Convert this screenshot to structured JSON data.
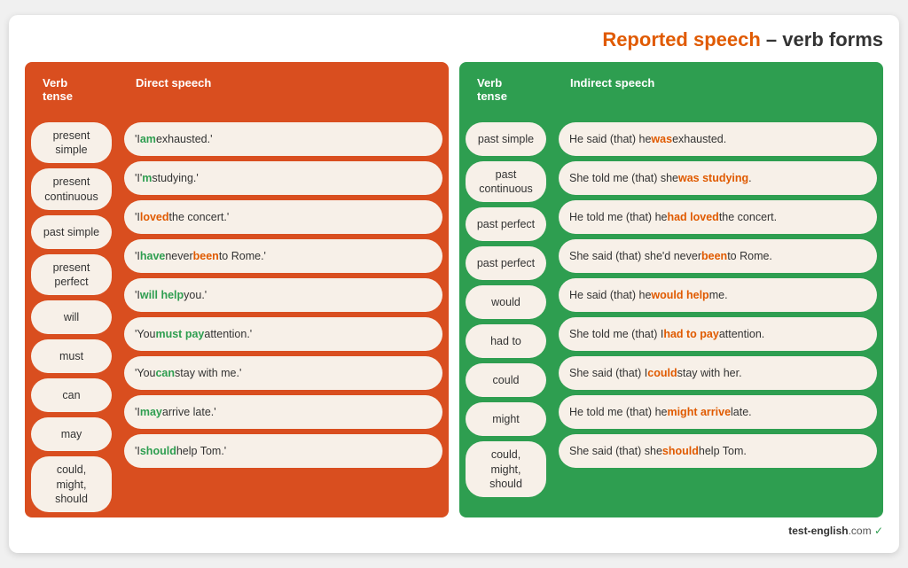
{
  "title": {
    "part1": "Reported speech",
    "separator": " – ",
    "part2": "verb forms"
  },
  "direct": {
    "col1_header": "Verb tense",
    "col2_header": "Direct speech",
    "rows": [
      {
        "tense": "present\nsimple",
        "speech_parts": [
          {
            "text": "'I ",
            "highlight": null
          },
          {
            "text": "am",
            "highlight": "green"
          },
          {
            "text": " exhausted.'",
            "highlight": null
          }
        ]
      },
      {
        "tense": "present\ncontinuous",
        "speech_parts": [
          {
            "text": "'I'",
            "highlight": null
          },
          {
            "text": "m",
            "highlight": "green"
          },
          {
            "text": " studying.'",
            "highlight": null
          }
        ]
      },
      {
        "tense": "past simple",
        "speech_parts": [
          {
            "text": "'I ",
            "highlight": null
          },
          {
            "text": "loved",
            "highlight": "orange"
          },
          {
            "text": " the concert.'",
            "highlight": null
          }
        ]
      },
      {
        "tense": "present\nperfect",
        "speech_parts": [
          {
            "text": "'I ",
            "highlight": null
          },
          {
            "text": "have",
            "highlight": "green"
          },
          {
            "text": " never ",
            "highlight": null
          },
          {
            "text": "been",
            "highlight": "orange"
          },
          {
            "text": " to Rome.'",
            "highlight": null
          }
        ]
      },
      {
        "tense": "will",
        "speech_parts": [
          {
            "text": "'I ",
            "highlight": null
          },
          {
            "text": "will help",
            "highlight": "green"
          },
          {
            "text": " you.'",
            "highlight": null
          }
        ]
      },
      {
        "tense": "must",
        "speech_parts": [
          {
            "text": "'You ",
            "highlight": null
          },
          {
            "text": "must pay",
            "highlight": "green"
          },
          {
            "text": " attention.'",
            "highlight": null
          }
        ]
      },
      {
        "tense": "can",
        "speech_parts": [
          {
            "text": "'You ",
            "highlight": null
          },
          {
            "text": "can",
            "highlight": "green"
          },
          {
            "text": " stay with me.'",
            "highlight": null
          }
        ]
      },
      {
        "tense": "may",
        "speech_parts": [
          {
            "text": "'I ",
            "highlight": null
          },
          {
            "text": "may",
            "highlight": "green"
          },
          {
            "text": " arrive late.'",
            "highlight": null
          }
        ]
      },
      {
        "tense": "could, might,\nshould",
        "speech_parts": [
          {
            "text": "'I ",
            "highlight": null
          },
          {
            "text": "should",
            "highlight": "green"
          },
          {
            "text": " help Tom.'",
            "highlight": null
          }
        ]
      }
    ]
  },
  "indirect": {
    "col1_header": "Verb tense",
    "col2_header": "Indirect speech",
    "rows": [
      {
        "tense": "past simple",
        "speech_parts": [
          {
            "text": "He said (that) he ",
            "highlight": null
          },
          {
            "text": "was",
            "highlight": "orange"
          },
          {
            "text": " exhausted.",
            "highlight": null
          }
        ]
      },
      {
        "tense": "past\ncontinuous",
        "speech_parts": [
          {
            "text": "She told me (that) she ",
            "highlight": null
          },
          {
            "text": "was studying",
            "highlight": "orange"
          },
          {
            "text": ".",
            "highlight": null
          }
        ]
      },
      {
        "tense": "past perfect",
        "speech_parts": [
          {
            "text": "He told me (that) he ",
            "highlight": null
          },
          {
            "text": "had loved",
            "highlight": "orange"
          },
          {
            "text": " the concert.",
            "highlight": null
          }
        ]
      },
      {
        "tense": "past perfect",
        "speech_parts": [
          {
            "text": "She said (that) she'd never ",
            "highlight": null
          },
          {
            "text": "been",
            "highlight": "orange"
          },
          {
            "text": " to Rome.",
            "highlight": null
          }
        ]
      },
      {
        "tense": "would",
        "speech_parts": [
          {
            "text": "He said (that) he ",
            "highlight": null
          },
          {
            "text": "would help",
            "highlight": "orange"
          },
          {
            "text": " me.",
            "highlight": null
          }
        ]
      },
      {
        "tense": "had to",
        "speech_parts": [
          {
            "text": "She told me (that) I ",
            "highlight": null
          },
          {
            "text": "had to pay",
            "highlight": "orange"
          },
          {
            "text": " attention.",
            "highlight": null
          }
        ]
      },
      {
        "tense": "could",
        "speech_parts": [
          {
            "text": "She said (that) I ",
            "highlight": null
          },
          {
            "text": "could",
            "highlight": "orange"
          },
          {
            "text": " stay with her.",
            "highlight": null
          }
        ]
      },
      {
        "tense": "might",
        "speech_parts": [
          {
            "text": "He told me (that) he ",
            "highlight": null
          },
          {
            "text": "might arrive",
            "highlight": "orange"
          },
          {
            "text": " late.",
            "highlight": null
          }
        ]
      },
      {
        "tense": "could, might,\nshould",
        "speech_parts": [
          {
            "text": "She said (that) she ",
            "highlight": null
          },
          {
            "text": "should",
            "highlight": "orange"
          },
          {
            "text": " help Tom.",
            "highlight": null
          }
        ]
      }
    ]
  },
  "footer": {
    "site": "test-english",
    "tld": ".com"
  }
}
